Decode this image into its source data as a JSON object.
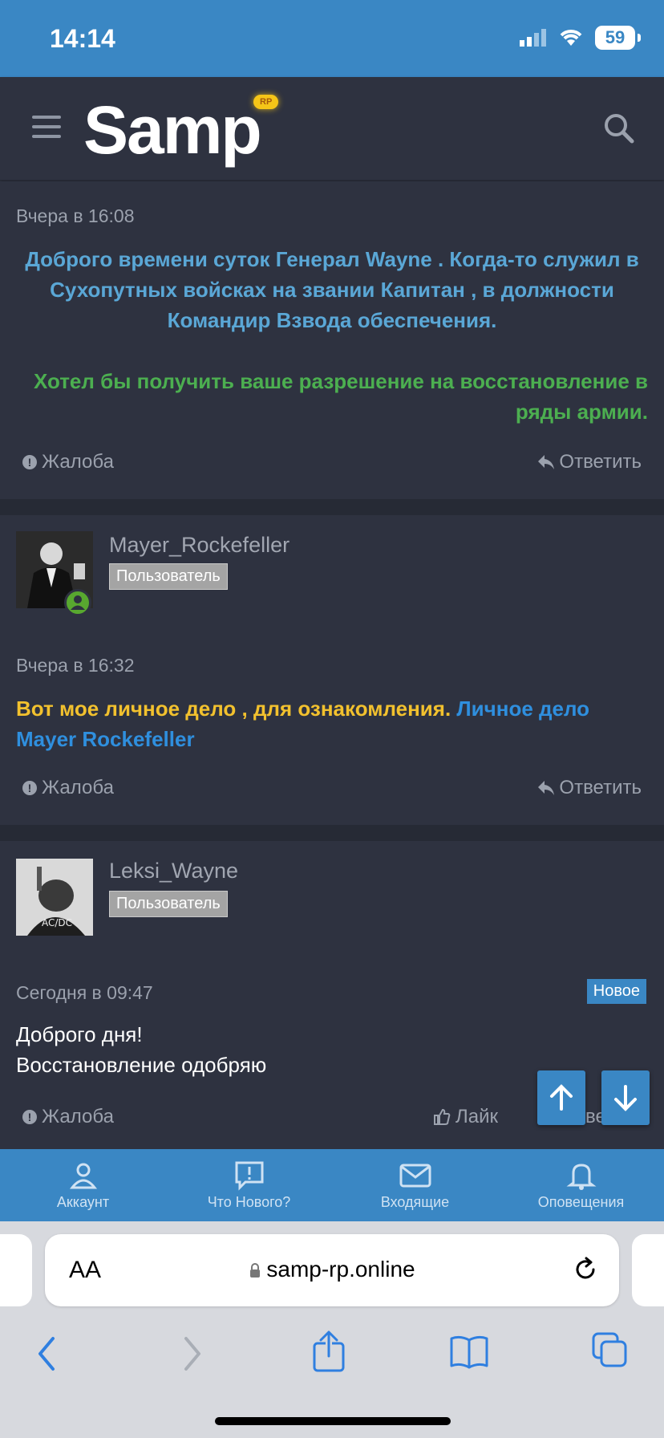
{
  "status": {
    "time": "14:14",
    "battery": "59"
  },
  "header": {
    "logo_text": "Samp",
    "logo_badge": "RP"
  },
  "posts": [
    {
      "date": "Вчера в 16:08",
      "lines_blue": [
        "Доброго времени суток Генерал Wayne . Когда-то служил в",
        "Сухопутных войсках на звании Капитан , в должности",
        "Командир Взвода обеспечения."
      ],
      "lines_green": [
        "Хотел бы получить ваше разрешение на восстановление в",
        "ряды армии."
      ],
      "report": "Жалоба",
      "reply": "Ответить"
    },
    {
      "username": "Mayer_Rockefeller",
      "role": "Пользователь",
      "date": "Вчера в 16:32",
      "text_yellow": "Вот мое личное дело , для ознакомления.",
      "link_part1": "Личное дело",
      "link_part2": "Mayer Rockefeller",
      "report": "Жалоба",
      "reply": "Ответить"
    },
    {
      "username": "Leksi_Wayne",
      "role": "Пользователь",
      "date": "Сегодня в 09:47",
      "new_badge": "Новое",
      "lines": [
        "Доброго дня!",
        "Восстановление одобряю"
      ],
      "report": "Жалоба",
      "like": "Лайк",
      "reply_partial": "ве"
    }
  ],
  "nav": [
    {
      "label": "Аккаунт",
      "icon": "account-icon"
    },
    {
      "label": "Что Нового?",
      "icon": "whats-new-icon"
    },
    {
      "label": "Входящие",
      "icon": "inbox-icon"
    },
    {
      "label": "Оповещения",
      "icon": "bell-icon"
    }
  ],
  "browser": {
    "aa": "AA",
    "url": "samp-rp.online"
  },
  "colors": {
    "accent": "#3a87c4",
    "bg": "#2e3240",
    "blue_text": "#5aa7d6",
    "green_text": "#4caf50",
    "yellow_text": "#f2c12e",
    "link_text": "#2f8fde"
  }
}
